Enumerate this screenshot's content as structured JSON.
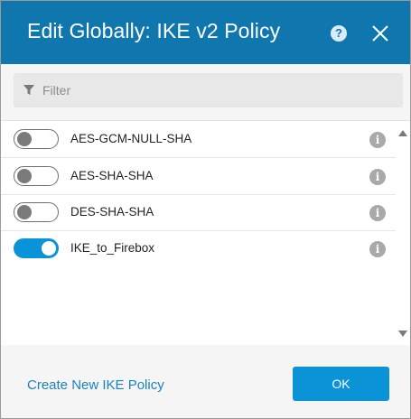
{
  "dialog": {
    "title": "Edit Globally: IKE v2 Policy",
    "help_icon": "question-circle-icon",
    "close_icon": "close-x-icon"
  },
  "filter": {
    "icon": "funnel-filter-icon",
    "placeholder": "Filter",
    "value": ""
  },
  "policies": [
    {
      "label": "AES-GCM-NULL-SHA",
      "enabled": false,
      "info_icon": "info-icon"
    },
    {
      "label": "AES-SHA-SHA",
      "enabled": false,
      "info_icon": "info-icon"
    },
    {
      "label": "DES-SHA-SHA",
      "enabled": false,
      "info_icon": "info-icon"
    },
    {
      "label": "IKE_to_Firebox",
      "enabled": true,
      "info_icon": "info-icon"
    }
  ],
  "footer": {
    "create_link": "Create New IKE Policy",
    "ok_label": "OK"
  },
  "colors": {
    "header": "#0f77ae",
    "accent": "#0a93d6",
    "link": "#1a82c4"
  }
}
